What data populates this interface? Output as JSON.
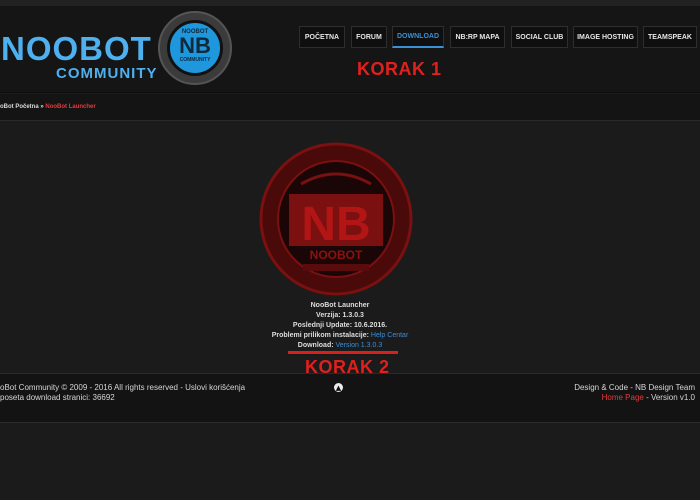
{
  "brand": {
    "name": "NOOBOT",
    "sub": "COMMUNITY",
    "logo_top": "NOOBOT",
    "logo_initials": "NB",
    "logo_bottom": "COMMUNITY",
    "accent_color": "#4fb0f0"
  },
  "nav": {
    "items": [
      {
        "label": "Početna",
        "active": false
      },
      {
        "label": "FORUM",
        "active": false
      },
      {
        "label": "DOWNLOAD",
        "active": true
      },
      {
        "label": "NB:RP MAPA",
        "active": false
      },
      {
        "label": "SOCIAL CLUB",
        "active": false
      },
      {
        "label": "IMAGE HOSTING",
        "active": false
      },
      {
        "label": "TEAMSPEAK",
        "active": false
      }
    ]
  },
  "annotations": {
    "korak1": "KORAK 1",
    "korak2": "KORAK 2",
    "color": "#e0201c"
  },
  "breadcrumb": {
    "home": "oBot Početna",
    "separator": "»",
    "current": "NooBot Launcher"
  },
  "emblem": {
    "initials": "NB",
    "name": "NOOBOT"
  },
  "launcher": {
    "title": "NooBot Launcher",
    "version_label": "Verzija:",
    "version": "1.3.0.3",
    "update_label": "Poslednji Update:",
    "update_date": "10.6.2016.",
    "problems_label": "Problemi prilikom instalacije:",
    "help_link": "Help Centar",
    "download_label": "Download:",
    "download_link": "Version 1.3.0.3"
  },
  "footer": {
    "copyright": "oBot Community © 2009 - 2016 All rights reserved - Uslovi korišćenja",
    "visits": "poseta download stranici: 36692",
    "design": "Design & Code - NB Design Team",
    "home_link": "Home Page",
    "version_text": "- Version v1.0",
    "scroll_icon": "arrow-up-icon"
  }
}
